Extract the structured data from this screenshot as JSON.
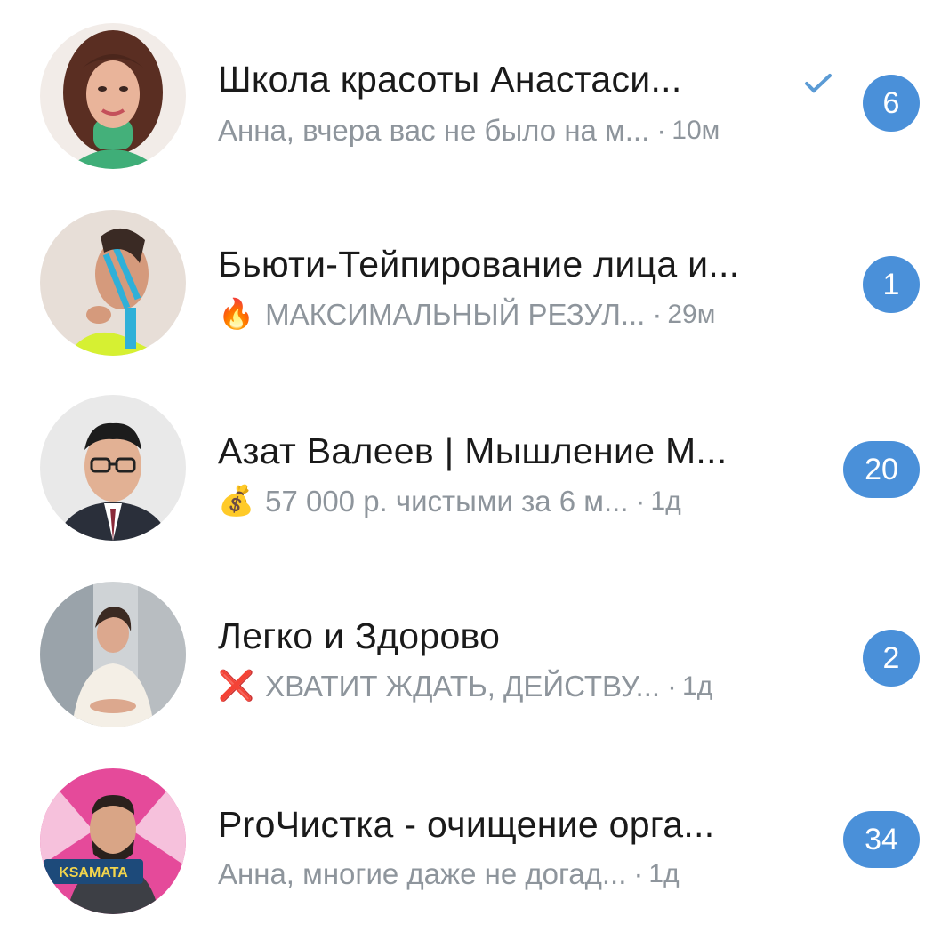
{
  "chats": [
    {
      "title": "Школа красоты Анастаси...",
      "preview": "Анна, вчера вас не было на м...",
      "time": "10м",
      "separator": "·",
      "badge": "6",
      "read_icon": "checkmark-icon",
      "avatar_icon": "woman-portrait"
    },
    {
      "title": "Бьюти-Тейпирование лица и...",
      "prefix_emoji": "🔥",
      "preview": "МАКСИМАЛЬНЫЙ РЕЗУЛ...",
      "time": "29м",
      "separator": "·",
      "badge": "1",
      "avatar_icon": "woman-taped-face"
    },
    {
      "title": "Азат Валеев | Мышление М...",
      "prefix_emoji": "💰",
      "preview": "57 000 р. чистыми за 6 м...",
      "time": "1д",
      "separator": "·",
      "badge": "20",
      "avatar_icon": "man-glasses-portrait"
    },
    {
      "title": "Легко и Здорово",
      "prefix_emoji": "❌",
      "preview": "ХВАТИТ ЖДАТЬ, ДЕЙСТВУ...",
      "time": "1д",
      "separator": "·",
      "badge": "2",
      "avatar_icon": "woman-sweater-portrait"
    },
    {
      "title": "PrоЧистка - очищение орга...",
      "preview": "Анна, многие даже не догад...",
      "time": "1д",
      "separator": "·",
      "badge": "34",
      "avatar_icon": "man-beard-portrait",
      "avatar_text": "KSAMATA"
    }
  ],
  "colors": {
    "badge": "#4a90d9",
    "title": "#1a1a1a",
    "preview": "#8e959c",
    "check": "#5b9bd5"
  }
}
